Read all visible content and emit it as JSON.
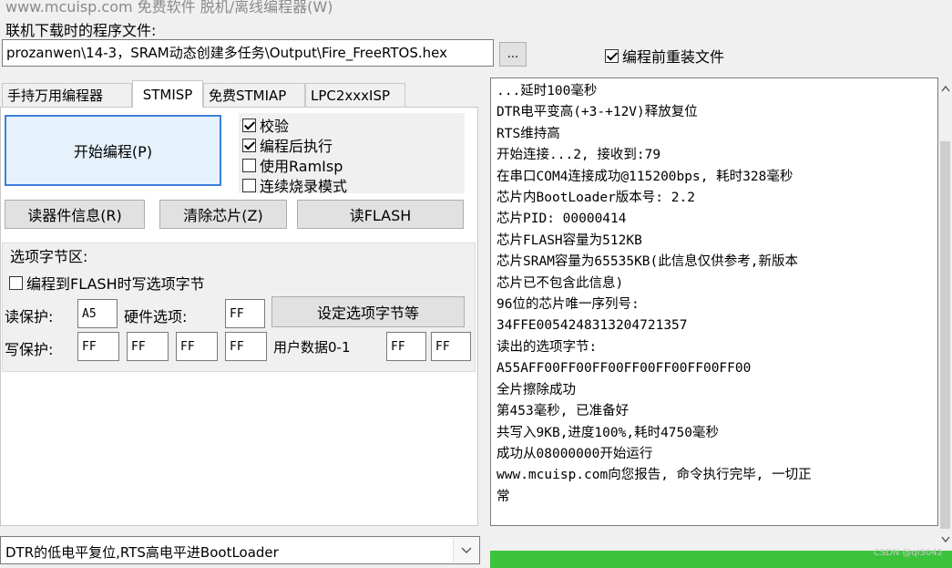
{
  "window": {
    "title": "www.mcuisp.com 免费软件 脱机/离线编程器(W)"
  },
  "file": {
    "label": "联机下载时的程序文件:",
    "path": "prozanwen\\14-3，SRAM动态创建多任务\\Output\\Fire_FreeRTOS.hex",
    "browse_label": "...",
    "reload_label": "编程前重装文件",
    "reload_checked": true
  },
  "tabs": [
    {
      "label": "手持万用编程器"
    },
    {
      "label": "STMISP",
      "active": true
    },
    {
      "label": "免费STMIAP"
    },
    {
      "label": "LPC2xxxISP"
    }
  ],
  "stmisp": {
    "start_label": "开始编程(P)",
    "options": [
      {
        "label": "校验",
        "checked": true
      },
      {
        "label": "编程后执行",
        "checked": true
      },
      {
        "label": "使用RamIsp",
        "checked": false
      },
      {
        "label": "连续烧录模式",
        "checked": false
      }
    ],
    "read_info_label": "读器件信息(R)",
    "erase_label": "清除芯片(Z)",
    "read_flash_label": "读FLASH",
    "option_bytes": {
      "group_label": "选项字节区:",
      "write_on_flash_label": "编程到FLASH时写选项字节",
      "write_on_flash_checked": false,
      "rdp_label": "读保护:",
      "rdp_value": "A5",
      "hw_label": "硬件选项:",
      "hw_value": "FF",
      "set_button": "设定选项字节等",
      "wrp_label": "写保护:",
      "wrp_values": [
        "FF",
        "FF",
        "FF",
        "FF"
      ],
      "user_data_label": "用户数据0-1",
      "user_data_values": [
        "FF",
        "FF"
      ]
    }
  },
  "log": {
    "lines": [
      "...延时100毫秒",
      "DTR电平变高(+3-+12V)释放复位",
      "RTS维持高",
      "开始连接...2, 接收到:79",
      "在串口COM4连接成功@115200bps, 耗时328毫秒",
      "芯片内BootLoader版本号: 2.2",
      "芯片PID: 00000414",
      "芯片FLASH容量为512KB",
      "芯片SRAM容量为65535KB(此信息仅供参考,新版本",
      "芯片已不包含此信息)",
      "96位的芯片唯一序列号:",
      "34FFE0054248313204721357",
      "读出的选项字节:",
      "A55AFF00FF00FF00FF00FF00FF00FF00",
      "全片擦除成功",
      "第453毫秒, 已准备好",
      "共写入9KB,进度100%,耗时4750毫秒",
      "成功从08000000开始运行",
      "www.mcuisp.com向您报告, 命令执行完毕, 一切正",
      "常"
    ],
    "progress": 1.0
  },
  "reset_mode": {
    "value": "DTR的低电平复位,RTS高电平进BootLoader"
  },
  "watermark": "CSDN @qi3042",
  "colors": {
    "progress": "#3bc33b",
    "focus": "#3c7fd9"
  }
}
